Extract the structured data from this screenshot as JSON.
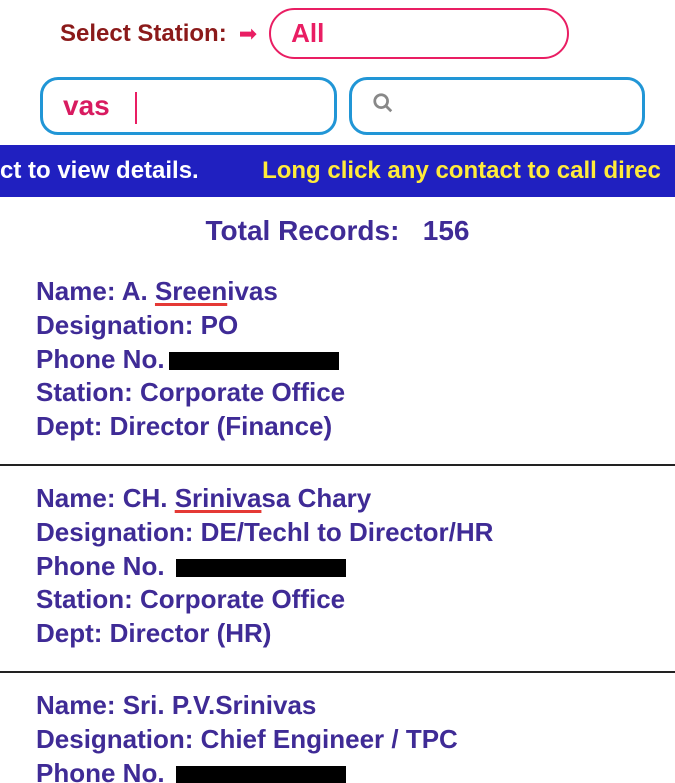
{
  "header": {
    "select_label": "Select Station:",
    "arrow_glyph": "➡",
    "station_value": "All"
  },
  "search": {
    "left_value": "vas",
    "search_icon": "🔍"
  },
  "marquee": {
    "part1": "ct to view details.",
    "part2": "Long click any contact to call direc"
  },
  "totals": {
    "label": "Total Records:",
    "count": "156"
  },
  "records": [
    {
      "name_prefix": "Name: A. ",
      "name_underlined": "Sreen",
      "name_suffix": "ivas",
      "designation": "Designation: PO",
      "phone_label": "Phone No.",
      "station": "Station: Corporate Office",
      "dept": "Dept: Director (Finance)"
    },
    {
      "name_prefix": "Name: CH. ",
      "name_underlined": "Sriniva",
      "name_suffix": "sa Chary",
      "designation": "Designation: DE/Techl to Director/HR",
      "phone_label": "Phone No.",
      "station": "Station: Corporate Office",
      "dept": "Dept: Director (HR)"
    },
    {
      "name_prefix": "Name: Sri. P.V.Srinivas",
      "name_underlined": "",
      "name_suffix": "",
      "designation": "Designation: Chief Engineer / TPC",
      "phone_label": "Phone No.",
      "station": "",
      "dept": ""
    }
  ]
}
